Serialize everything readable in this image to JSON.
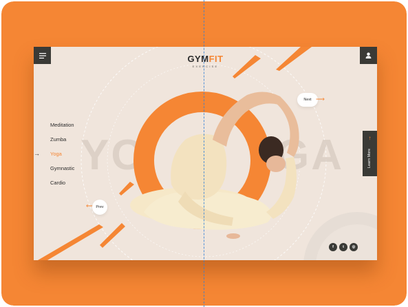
{
  "brand": {
    "logo_gym": "GYM",
    "logo_fit": "FIT",
    "logo_sub": "EXERCISE"
  },
  "nav": {
    "items": [
      {
        "label": "Meditation",
        "active": false
      },
      {
        "label": "Zumba",
        "active": false
      },
      {
        "label": "Yoga",
        "active": true
      },
      {
        "label": "Gymnastic",
        "active": false
      },
      {
        "label": "Cardio",
        "active": false
      }
    ],
    "active_marker": "→"
  },
  "hero": {
    "watermark_left": "YO",
    "watermark_right": "GA"
  },
  "carousel": {
    "next_label": "Next",
    "next_arrow": "⟶",
    "prev_label": "Prev",
    "prev_arrow": "⟵"
  },
  "cta": {
    "label": "Learn More",
    "arrow": "↑"
  },
  "social": {
    "facebook_glyph": "f",
    "twitter_glyph": "t",
    "instagram_glyph": "◎"
  },
  "icons": {
    "menu": "hamburger-icon",
    "user": "user-icon",
    "facebook": "facebook-icon",
    "twitter": "twitter-icon",
    "instagram": "instagram-icon"
  },
  "colors": {
    "accent": "#f58634",
    "dark": "#3a3a36",
    "card_bg": "#f0e5dc",
    "page_bg": "#f58634"
  }
}
